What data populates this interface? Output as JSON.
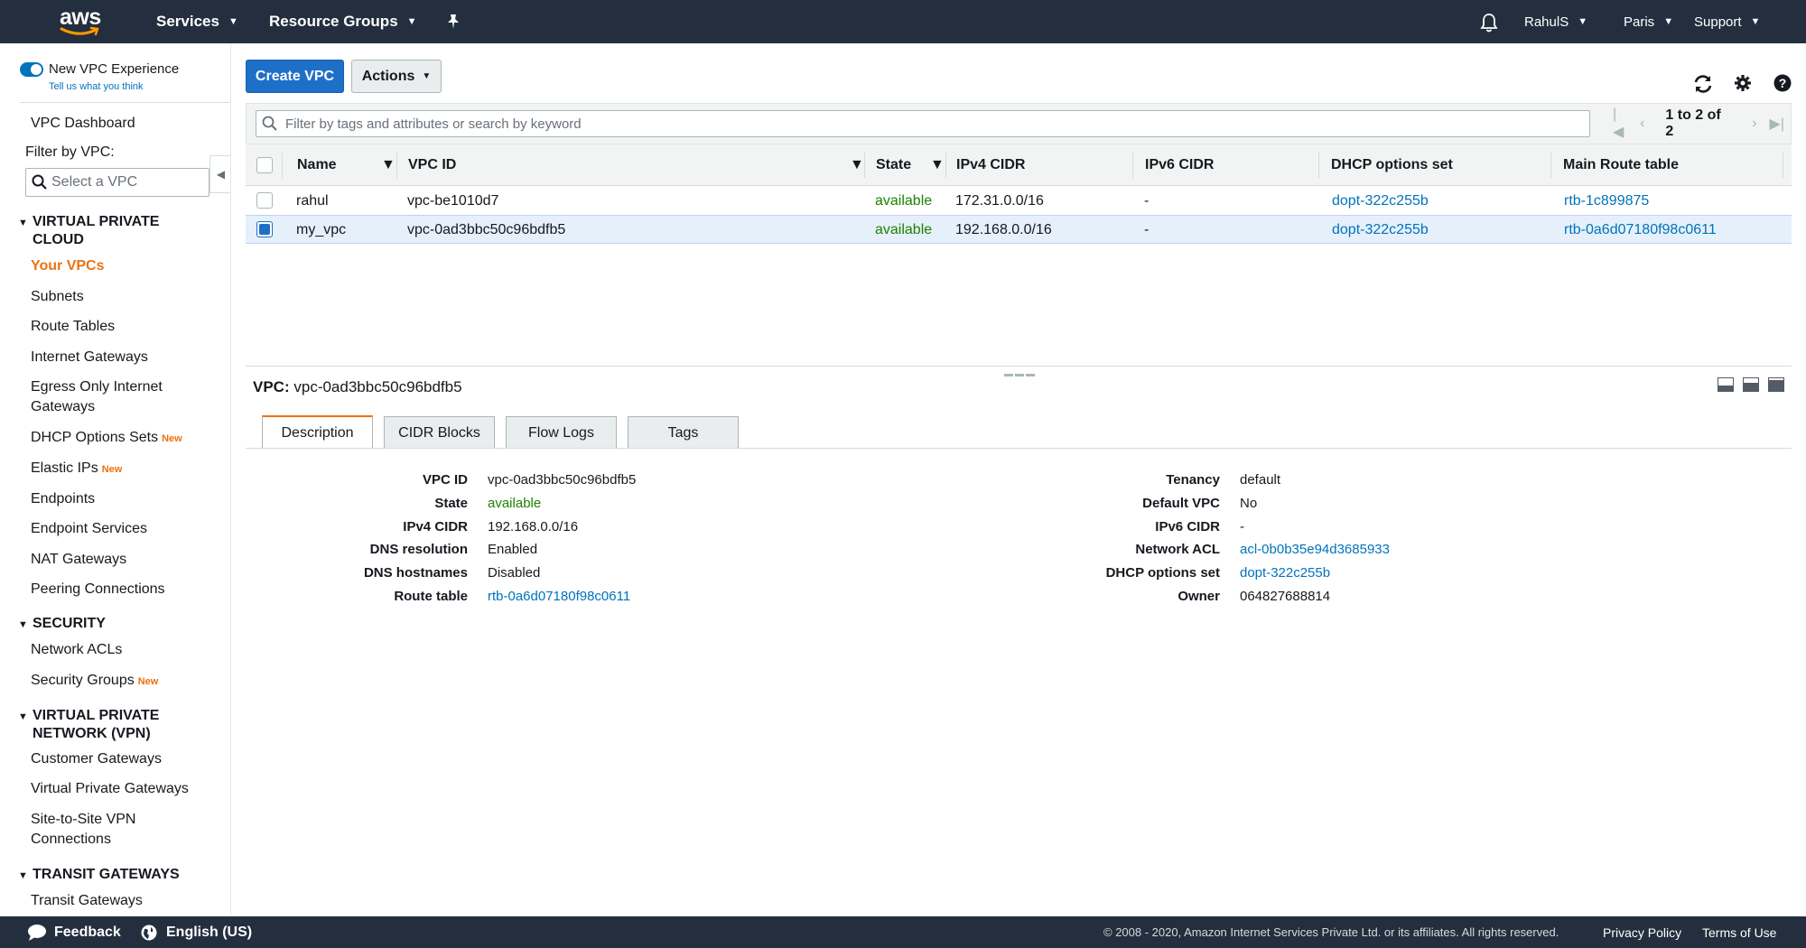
{
  "topnav": {
    "logo_text": "aws",
    "services": "Services",
    "resource_groups": "Resource Groups",
    "user": "RahulS",
    "region": "Paris",
    "support": "Support"
  },
  "sidebar": {
    "new_vpc_experience": "New VPC Experience",
    "tell_us": "Tell us what you think",
    "vpc_dashboard": "VPC Dashboard",
    "filter_label": "Filter by VPC:",
    "filter_placeholder": "Select a VPC",
    "sections": [
      {
        "title_line1": "VIRTUAL PRIVATE",
        "title_line2": "CLOUD",
        "items": [
          {
            "label": "Your VPCs"
          },
          {
            "label": "Subnets"
          },
          {
            "label": "Route Tables"
          },
          {
            "label": "Internet Gateways"
          },
          {
            "label": "Egress Only Internet",
            "label2": "Gateways"
          },
          {
            "label": "DHCP Options Sets",
            "badge": "New"
          },
          {
            "label": "Elastic IPs",
            "badge": "New"
          },
          {
            "label": "Endpoints"
          },
          {
            "label": "Endpoint Services"
          },
          {
            "label": "NAT Gateways"
          },
          {
            "label": "Peering Connections"
          }
        ]
      },
      {
        "title_line1": "SECURITY",
        "items": [
          {
            "label": "Network ACLs"
          },
          {
            "label": "Security Groups",
            "badge": "New"
          }
        ]
      },
      {
        "title_line1": "VIRTUAL PRIVATE",
        "title_line2": "NETWORK (VPN)",
        "items": [
          {
            "label": "Customer Gateways"
          },
          {
            "label": "Virtual Private Gateways"
          },
          {
            "label": "Site-to-Site VPN",
            "label2": "Connections"
          }
        ]
      },
      {
        "title_line1": "TRANSIT GATEWAYS",
        "items": [
          {
            "label": "Transit Gateways"
          }
        ]
      }
    ]
  },
  "toolbar": {
    "create_vpc": "Create VPC",
    "actions": "Actions"
  },
  "search": {
    "placeholder": "Filter by tags and attributes or search by keyword"
  },
  "pager": {
    "count": "1 to 2 of 2"
  },
  "table": {
    "columns": [
      "Name",
      "VPC ID",
      "State",
      "IPv4 CIDR",
      "IPv6 CIDR",
      "DHCP options set",
      "Main Route table"
    ],
    "rows": [
      {
        "name": "rahul",
        "vpc_id": "vpc-be1010d7",
        "state": "available",
        "ipv4": "172.31.0.0/16",
        "ipv6": "-",
        "dhcp": "dopt-322c255b",
        "route": "rtb-1c899875",
        "selected": false
      },
      {
        "name": "my_vpc",
        "vpc_id": "vpc-0ad3bbc50c96bdfb5",
        "state": "available",
        "ipv4": "192.168.0.0/16",
        "ipv6": "-",
        "dhcp": "dopt-322c255b",
        "route": "rtb-0a6d07180f98c0611",
        "selected": true
      }
    ]
  },
  "details": {
    "title_label": "VPC:",
    "title_value": "vpc-0ad3bbc50c96bdfb5",
    "tabs": [
      "Description",
      "CIDR Blocks",
      "Flow Logs",
      "Tags"
    ],
    "left": [
      {
        "k": "VPC ID",
        "v": "vpc-0ad3bbc50c96bdfb5"
      },
      {
        "k": "State",
        "v": "available"
      },
      {
        "k": "IPv4 CIDR",
        "v": "192.168.0.0/16"
      },
      {
        "k": "DNS resolution",
        "v": "Enabled"
      },
      {
        "k": "DNS hostnames",
        "v": "Disabled"
      },
      {
        "k": "Route table",
        "v": "rtb-0a6d07180f98c0611"
      }
    ],
    "right": [
      {
        "k": "Tenancy",
        "v": "default"
      },
      {
        "k": "Default VPC",
        "v": "No"
      },
      {
        "k": "IPv6 CIDR",
        "v": "-"
      },
      {
        "k": "Network ACL",
        "v": "acl-0b0b35e94d3685933"
      },
      {
        "k": "DHCP options set",
        "v": "dopt-322c255b"
      },
      {
        "k": "Owner",
        "v": "064827688814"
      }
    ]
  },
  "footer": {
    "feedback": "Feedback",
    "language": "English (US)",
    "copyright": "© 2008 - 2020, Amazon Internet Services Private Ltd. or its affiliates. All rights reserved.",
    "privacy": "Privacy Policy",
    "terms": "Terms of Use"
  },
  "colors": {
    "nav_bg": "#232f3e",
    "primary": "#1e6fc8",
    "accent": "#ec7211",
    "link": "#0073bb",
    "ok": "#1d8102"
  },
  "icons": [
    "bell-icon",
    "pin-icon",
    "search-icon",
    "refresh-icon",
    "gear-icon",
    "help-icon",
    "chat-icon",
    "globe-icon"
  ]
}
